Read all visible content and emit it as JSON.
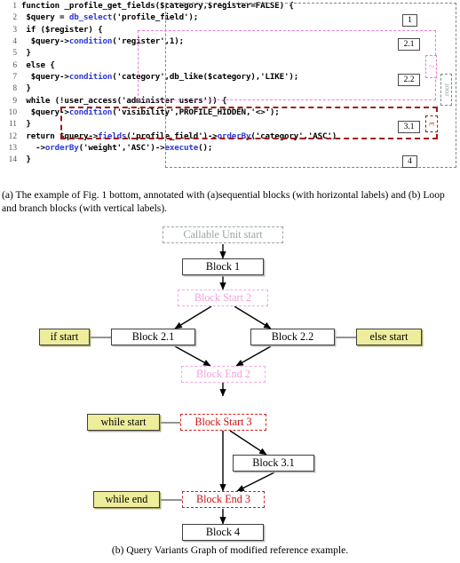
{
  "figure_a": {
    "code": [
      {
        "n": "1",
        "segments": [
          {
            "t": "function _profile_get_fields($category,$register=FALSE) {",
            "k": "plain"
          }
        ]
      },
      {
        "n": "2",
        "segments": [
          {
            "t": " $query = ",
            "k": "plain"
          },
          {
            "t": "db_select",
            "k": "fn"
          },
          {
            "t": "('profile_field');",
            "k": "plain"
          }
        ]
      },
      {
        "n": "3",
        "segments": [
          {
            "t": " if ($register) {",
            "k": "plain"
          }
        ]
      },
      {
        "n": "4",
        "segments": [
          {
            "t": "  $query->",
            "k": "plain"
          },
          {
            "t": "condition",
            "k": "fn"
          },
          {
            "t": "('register',1);",
            "k": "plain"
          }
        ]
      },
      {
        "n": "5",
        "segments": [
          {
            "t": " }",
            "k": "plain"
          }
        ]
      },
      {
        "n": "6",
        "segments": [
          {
            "t": " else {",
            "k": "plain"
          }
        ]
      },
      {
        "n": "7",
        "segments": [
          {
            "t": "  $query->",
            "k": "plain"
          },
          {
            "t": "condition",
            "k": "fn"
          },
          {
            "t": "('category',db_like($category),'LIKE');",
            "k": "plain"
          }
        ]
      },
      {
        "n": "8",
        "segments": [
          {
            "t": " }",
            "k": "plain"
          }
        ]
      },
      {
        "n": "9",
        "segments": [
          {
            "t": " while (!user_access('administer users')) {",
            "k": "plain"
          }
        ]
      },
      {
        "n": "10",
        "segments": [
          {
            "t": "  $query->",
            "k": "plain"
          },
          {
            "t": "condition",
            "k": "fn"
          },
          {
            "t": "('visibility',PROFILE_HIDDEN,'<>');",
            "k": "plain"
          }
        ]
      },
      {
        "n": "11",
        "segments": [
          {
            "t": " }",
            "k": "plain"
          }
        ]
      },
      {
        "n": "12",
        "segments": [
          {
            "t": " return $query->",
            "k": "plain"
          },
          {
            "t": "fields",
            "k": "fn"
          },
          {
            "t": "('profile_field')->",
            "k": "plain"
          },
          {
            "t": "orderBy",
            "k": "fn"
          },
          {
            "t": "('category','ASC')",
            "k": "plain"
          }
        ]
      },
      {
        "n": "13",
        "segments": [
          {
            "t": "   ->",
            "k": "plain"
          },
          {
            "t": "orderBy",
            "k": "fn"
          },
          {
            "t": "('weight','ASC')->",
            "k": "plain"
          },
          {
            "t": "execute",
            "k": "fn"
          },
          {
            "t": "();",
            "k": "plain"
          }
        ]
      },
      {
        "n": "14",
        "segments": [
          {
            "t": " }",
            "k": "plain"
          }
        ]
      }
    ],
    "horizontal_labels": [
      {
        "id": "label-1",
        "text": "1"
      },
      {
        "id": "label-2-1",
        "text": "2.1"
      },
      {
        "id": "label-2-2",
        "text": "2.2"
      },
      {
        "id": "label-3-1",
        "text": "3.1"
      },
      {
        "id": "label-4",
        "text": "4"
      }
    ],
    "vertical_labels": [
      {
        "id": "vlabel-2",
        "text": "2",
        "color": "#f0a6de"
      },
      {
        "id": "vlabel-root",
        "text": "root",
        "color": "#98a5a1"
      },
      {
        "id": "vlabel-3",
        "text": "3",
        "color": "#a31515"
      }
    ],
    "caption": "(a) The example of Fig. 1 bottom, annotated with (a)sequential blocks (with horizontal labels) and (b) Loop and branch blocks (with vertical labels)."
  },
  "figure_b": {
    "nodes": {
      "callable_unit_start": "Callable Unit start",
      "block_1": "Block 1",
      "block_start_2": "Block Start 2",
      "block_2_1": "Block 2.1",
      "block_2_2": "Block 2.2",
      "if_start": "if start",
      "else_start": "else start",
      "block_end_2": "Block End 2",
      "while_start": "while start",
      "block_start_3": "Block Start 3",
      "block_3_1": "Block 3.1",
      "while_end": "while end",
      "block_end_3": "Block End 3",
      "block_4": "Block 4"
    },
    "caption": "(b) Query Variants Graph of modified reference example."
  },
  "colors": {
    "keyword_blue": "#2b37d8",
    "pink_dashed": "#f07ad0",
    "red_dashed": "#a31515",
    "gray_dashed": "#7a8a85",
    "yellow_fill": "#eded9c",
    "node_border": "#3f3f3f"
  }
}
